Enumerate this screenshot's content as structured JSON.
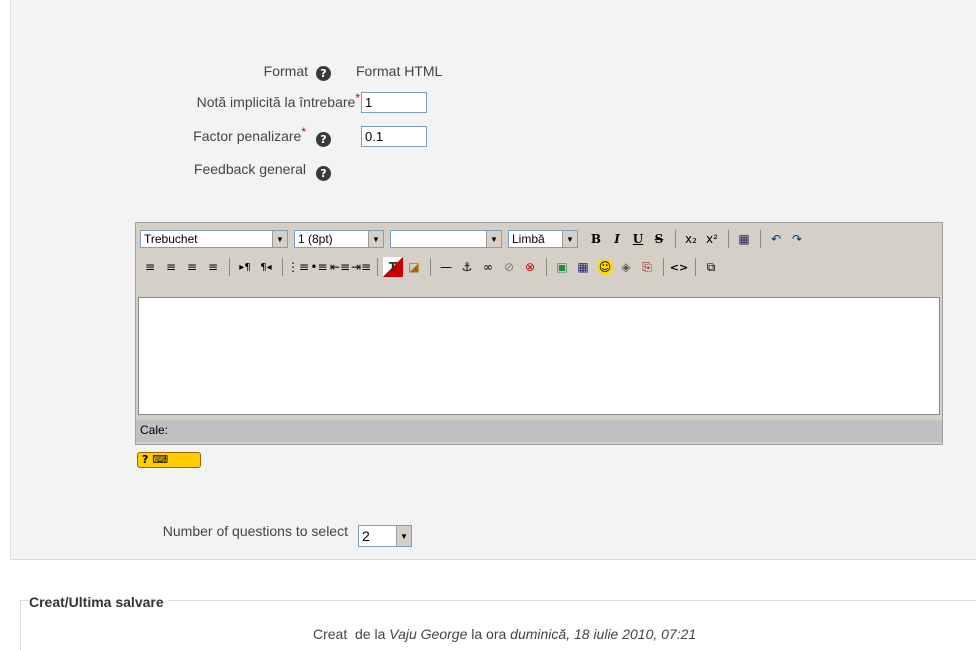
{
  "form": {
    "format": {
      "label": "Format",
      "value": "Format HTML"
    },
    "default_mark": {
      "label": "Notă implicită la întrebare",
      "required": "*",
      "value": "1"
    },
    "penalty": {
      "label": "Factor penalizare",
      "required": "*",
      "value": "0.1"
    },
    "feedback": {
      "label": "Feedback general"
    },
    "help_glyph": "?"
  },
  "editor": {
    "font": "Trebuchet",
    "size": "1 (8pt)",
    "heading": "",
    "language": "Limbă",
    "path_label": "Cale:",
    "keyboard_badge": "? ⌨",
    "toolbar_row1": [
      "B",
      "I",
      "U",
      "S",
      "x₂",
      "x²",
      "▦",
      "↶",
      "↷"
    ],
    "toolbar_row2": [
      "≡",
      "≡",
      "≡",
      "≡",
      "▸¶",
      "¶◂",
      "⋮≡",
      "•≡",
      "⇤≡",
      "⇥≡",
      "T",
      "◪",
      "—",
      "⚓",
      "∞",
      "⊘",
      "⊗",
      "▣",
      "▦",
      "☺",
      "◈",
      "⎘",
      "<>",
      "⧉"
    ]
  },
  "select_count": {
    "label": "Number of questions to select",
    "value": "2"
  },
  "created": {
    "legend": "Creat/Ultima salvare",
    "label": "Creat",
    "prefix": "de la",
    "author": "Vaju George",
    "middle": "la ora",
    "date": "duminică, 18 iulie 2010, 07:21"
  }
}
